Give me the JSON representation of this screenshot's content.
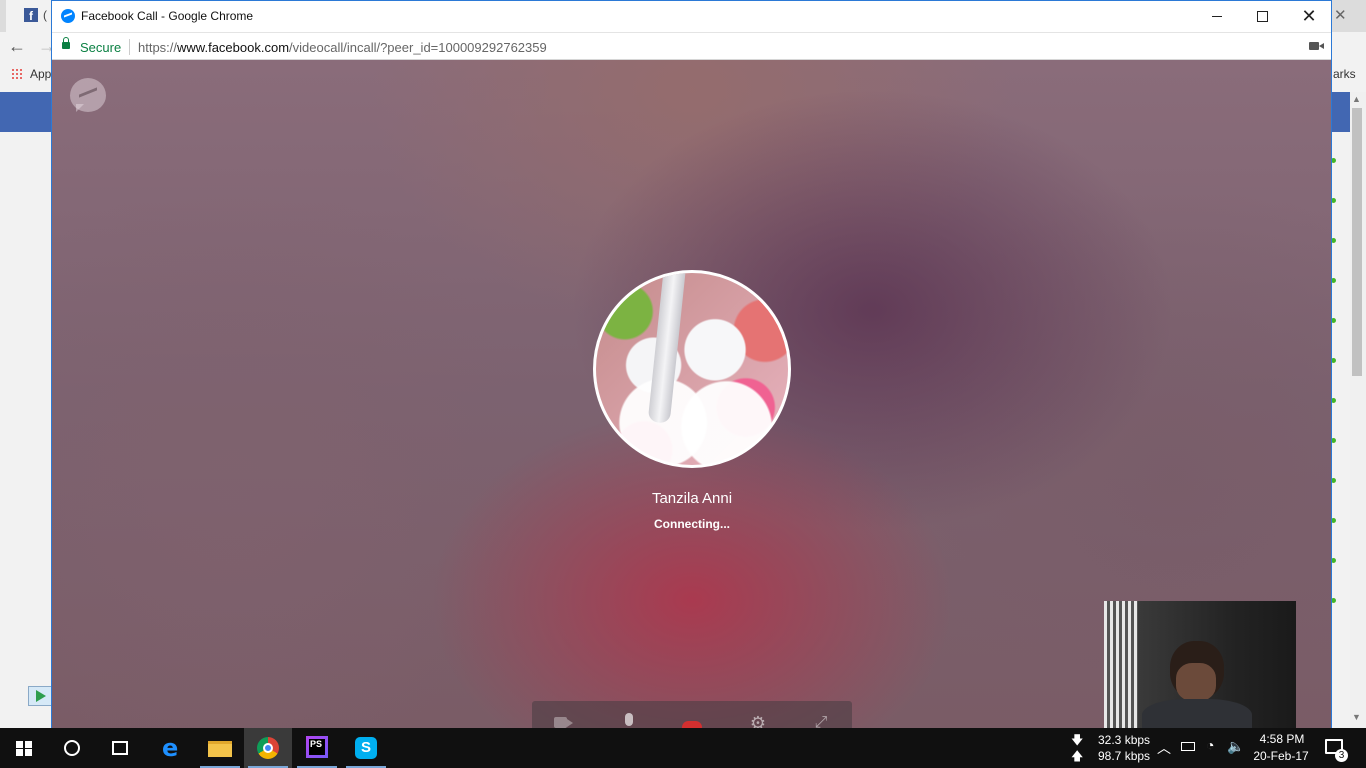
{
  "background_browser": {
    "tab_label": "(",
    "apps_label": "Apps",
    "bookmarks_label": "arks"
  },
  "popup": {
    "window_title": "Facebook Call - Google Chrome",
    "secure_label": "Secure",
    "url_scheme": "https://",
    "url_host": "www.facebook.com",
    "url_path": "/videocall/incall/?peer_id=100009292762359"
  },
  "call": {
    "caller_name": "Tanzila Anni",
    "status": "Connecting...",
    "controls": [
      "video-icon",
      "microphone-icon",
      "end-call-icon",
      "gear-icon",
      "fullscreen-icon"
    ]
  },
  "taskbar": {
    "apps": [
      "windows-start",
      "search",
      "task-view",
      "edge",
      "file-explorer",
      "chrome",
      "phpstorm",
      "skype"
    ],
    "phpstorm_label": "PS",
    "skype_label": "S",
    "net_down": "32.3 kbps",
    "net_up": "98.7 kbps",
    "time": "4:58 PM",
    "date": "20-Feb-17",
    "notification_count": "3"
  },
  "colors": {
    "facebook_blue": "#4267b2",
    "secure_green": "#0b8043",
    "end_call_red": "#d32f2f",
    "taskbar": "#101010"
  }
}
